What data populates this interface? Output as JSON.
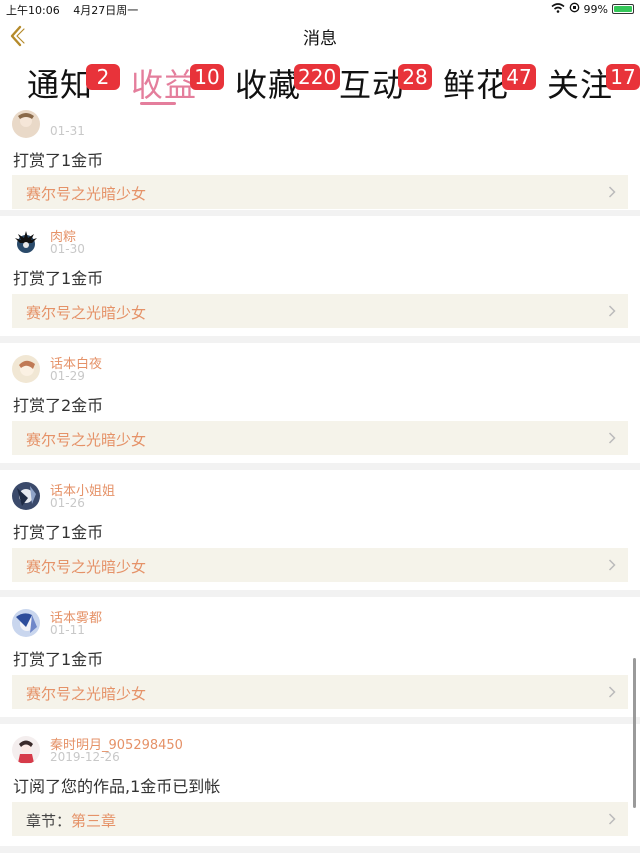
{
  "status": {
    "time": "上午10:06",
    "date": "4月27日周一",
    "battery": "99%",
    "battery_level": 0.99
  },
  "header": {
    "title": "消息",
    "back_icon": "chevron-left-icon"
  },
  "tabs": [
    {
      "label": "通知",
      "badge": "2",
      "active": false
    },
    {
      "label": "收益",
      "badge": "10",
      "active": true
    },
    {
      "label": "收藏",
      "badge": "220",
      "active": false
    },
    {
      "label": "互动",
      "badge": "28",
      "active": false
    },
    {
      "label": "鲜花",
      "badge": "47",
      "active": false
    },
    {
      "label": "关注",
      "badge": "17",
      "active": false
    }
  ],
  "feed": {
    "items": [
      {
        "user": "",
        "date": "01-31",
        "action": "打赏了1金币",
        "work_prefix": "",
        "work_title": "赛尔号之光暗少女"
      },
      {
        "user": "肉粽",
        "date": "01-30",
        "action": "打赏了1金币",
        "work_prefix": "",
        "work_title": "赛尔号之光暗少女"
      },
      {
        "user": "话本白夜",
        "date": "01-29",
        "action": "打赏了2金币",
        "work_prefix": "",
        "work_title": "赛尔号之光暗少女"
      },
      {
        "user": "话本小姐姐",
        "date": "01-26",
        "action": "打赏了1金币",
        "work_prefix": "",
        "work_title": "赛尔号之光暗少女"
      },
      {
        "user": "话本雾都",
        "date": "01-11",
        "action": "打赏了1金币",
        "work_prefix": "",
        "work_title": "赛尔号之光暗少女"
      },
      {
        "user": "秦时明月_905298450",
        "date": "2019-12-26",
        "action": "订阅了您的作品,1金币已到帐",
        "work_prefix": "章节：",
        "work_title": "第三章"
      }
    ]
  },
  "colors": {
    "accent": "#e47e9c",
    "badge": "#e8333a",
    "name": "#e59268",
    "back": "#b58a2a"
  }
}
